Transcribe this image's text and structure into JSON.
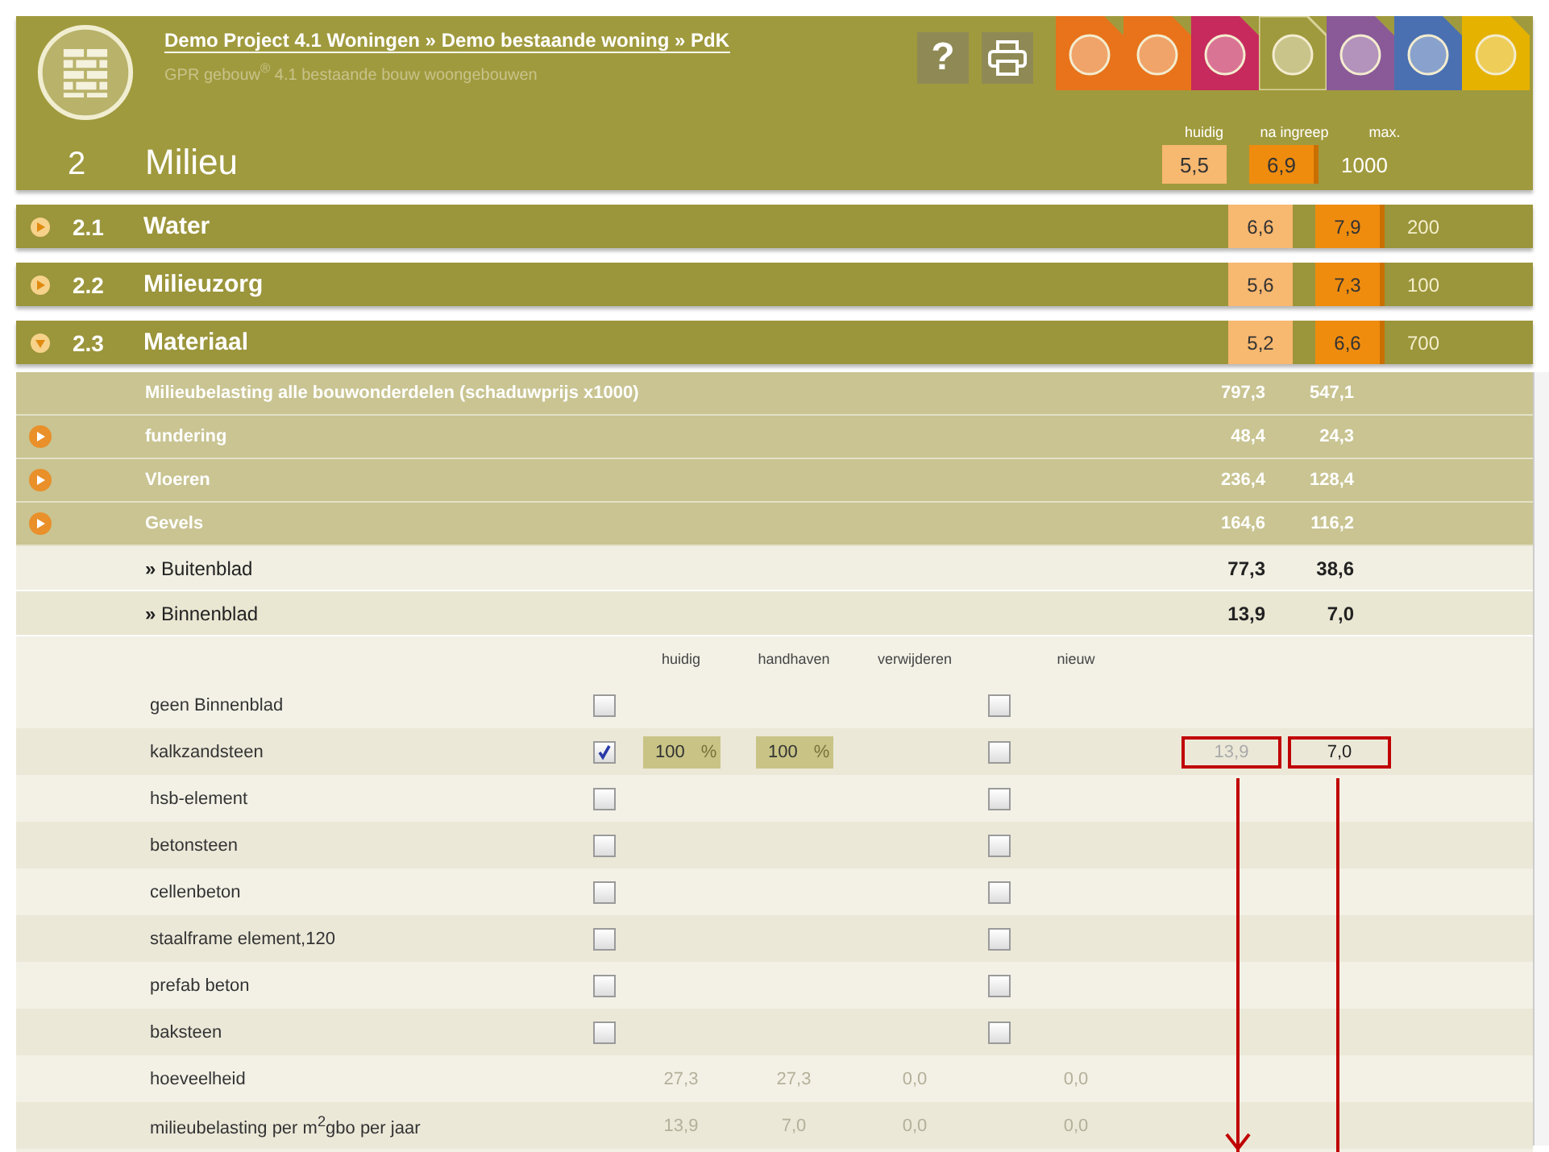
{
  "header": {
    "breadcrumb": "Demo Project 4.1 Woningen » Demo bestaande woning » PdK",
    "subtitle": "GPR gebouw$^{®}$ 4.1 bestaande bouw woongebouwen",
    "help": "?",
    "tabs": [
      {
        "color": "#e8731a",
        "selected": false
      },
      {
        "color": "#e8731a",
        "selected": false
      },
      {
        "color": "#c72a5c",
        "selected": false
      },
      {
        "color": "#a09a3e",
        "selected": true
      },
      {
        "color": "#8a5a98",
        "selected": false
      },
      {
        "color": "#4a70b2",
        "selected": false
      },
      {
        "color": "#e5b200",
        "selected": false
      }
    ],
    "score_labels": [
      "huidig",
      "na ingreep",
      "max."
    ],
    "number": "2",
    "title": "Milieu",
    "huidig": "5,5",
    "na_ingreep": "6,9",
    "max": "1000"
  },
  "sections": [
    {
      "number": "2.1",
      "title": "Water",
      "huidig": "6,6",
      "na_ingreep": "7,9",
      "max": "200",
      "expanded": false
    },
    {
      "number": "2.2",
      "title": "Milieuzorg",
      "huidig": "5,6",
      "na_ingreep": "7,3",
      "max": "100",
      "expanded": false
    },
    {
      "number": "2.3",
      "title": "Materiaal",
      "huidig": "5,2",
      "na_ingreep": "6,6",
      "max": "700",
      "expanded": true
    }
  ],
  "summary_rows": [
    {
      "kind": "total",
      "label": "Milieubelasting alle bouwonderdelen (schaduwprijs x1000)",
      "huidig": "797,3",
      "na_ingreep": "547,1"
    },
    {
      "kind": "group",
      "label": "fundering",
      "huidig": "48,4",
      "na_ingreep": "24,3"
    },
    {
      "kind": "group",
      "label": "Vloeren",
      "huidig": "236,4",
      "na_ingreep": "128,4"
    },
    {
      "kind": "group",
      "label": "Gevels",
      "huidig": "164,6",
      "na_ingreep": "116,2"
    },
    {
      "kind": "sub",
      "label": "**»** Buitenblad",
      "huidig": "77,3",
      "na_ingreep": "38,6"
    },
    {
      "kind": "sub",
      "label": "**»** Binnenblad",
      "huidig": "13,9",
      "na_ingreep": "7,0"
    }
  ],
  "option_columns": [
    "huidig",
    "handhaven",
    "verwijderen",
    "nieuw"
  ],
  "options": [
    {
      "label": "geen Binnenblad",
      "checked": false,
      "new_checked": false
    },
    {
      "label": "kalkzandsteen",
      "checked": true,
      "huidig": "100",
      "huidig_unit": "%",
      "handhaven": "100",
      "handhaven_unit": "%",
      "new_checked": false,
      "result_huidig": "13,9",
      "result_na_ingreep": "7,0",
      "annotated": true
    },
    {
      "label": "hsb-element",
      "checked": false,
      "new_checked": false
    },
    {
      "label": "betonsteen",
      "checked": false,
      "new_checked": false
    },
    {
      "label": "cellenbeton",
      "checked": false,
      "new_checked": false
    },
    {
      "label": "staalframe element,120",
      "checked": false,
      "new_checked": false
    },
    {
      "label": "prefab beton",
      "checked": false,
      "new_checked": false
    },
    {
      "label": "baksteen",
      "checked": false,
      "new_checked": false
    }
  ],
  "totals": [
    {
      "label": "hoeveelheid",
      "values": [
        "27,3",
        "27,3",
        "0,0",
        "0,0"
      ]
    },
    {
      "label": "milieubelasting per m$^{2}$gbo per jaar",
      "values": [
        "13,9",
        "7,0",
        "0,0",
        "0,0"
      ]
    }
  ],
  "annotation_arrows": [
    {
      "head": true
    },
    {
      "head": false
    }
  ]
}
